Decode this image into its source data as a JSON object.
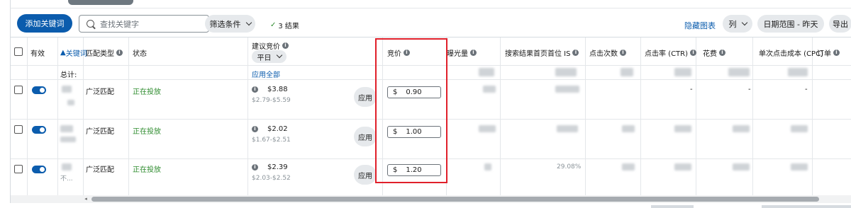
{
  "toolbar": {
    "add_keyword": "添加关键词",
    "search_placeholder": "查找关键字",
    "filter_label": "筛选条件",
    "results_count": "3 结果",
    "hide_chart": "隐藏图表",
    "columns": "列",
    "date_range": "日期范围 - 昨天",
    "export": "导出"
  },
  "headers": {
    "enabled": "有效",
    "keyword": "关键词",
    "match_type": "匹配类型",
    "status": "状态",
    "suggested_bid": "建议竞价",
    "suggested_bid_mode": "平日",
    "bid": "竞价",
    "impressions": "曝光量",
    "top_of_search_is": "搜索结果首页首位 IS",
    "clicks": "点击次数",
    "ctr": "点击率 (CTR)",
    "spend": "花费",
    "cpc": "单次点击成本 (CPC)",
    "orders": "订单"
  },
  "totals": {
    "label": "总计:",
    "apply_all": "应用全部"
  },
  "rows": [
    {
      "enabled": true,
      "match_type": "广泛匹配",
      "status": "正在投放",
      "suggested_bid": "$3.88",
      "suggested_range": "$2.79-$5.59",
      "apply": "应用",
      "currency": "$",
      "bid": "0.90",
      "ctr": "-",
      "spend": "-",
      "cpc": "-"
    },
    {
      "enabled": true,
      "match_type": "广泛匹配",
      "status": "正在投放",
      "suggested_bid": "$2.02",
      "suggested_range": "$1.67-$2.51",
      "apply": "应用",
      "currency": "$",
      "bid": "1.00"
    },
    {
      "enabled": true,
      "keyword_fragment": "不...",
      "match_type": "广泛匹配",
      "status": "正在投放",
      "suggested_bid": "$2.39",
      "suggested_range": "$2.03-$2.52",
      "apply": "应用",
      "currency": "$",
      "bid": "1.20",
      "top_is": "29.08%"
    }
  ],
  "colors": {
    "primary": "#0b5cad",
    "status_green": "#2f8c2f",
    "highlight_red": "#e0202a"
  }
}
